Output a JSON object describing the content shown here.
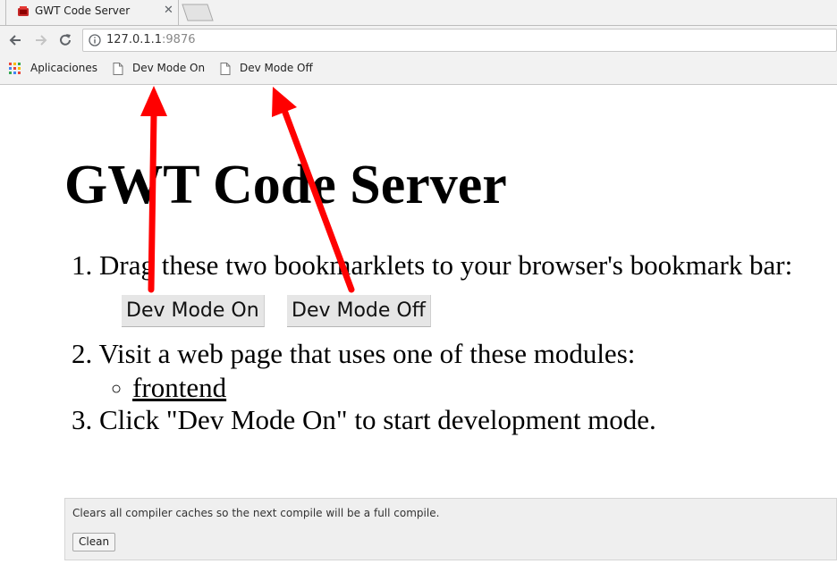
{
  "browser": {
    "tab_title": "GWT Code Server",
    "close_glyph": "✕",
    "url_host": "127.0.1.1",
    "url_port": ":9876",
    "bookmarks": [
      {
        "label": "Aplicaciones",
        "icon": "apps-grid-icon"
      },
      {
        "label": "Dev Mode On",
        "icon": "page-icon"
      },
      {
        "label": "Dev Mode Off",
        "icon": "page-icon"
      }
    ]
  },
  "page": {
    "title": "GWT Code Server",
    "steps": [
      {
        "number": "1.",
        "text": "Drag these two bookmarklets to your browser's bookmark bar:"
      },
      {
        "number": "2.",
        "text": "Visit a web page that uses one of these modules:"
      },
      {
        "number": "3.",
        "text": "Click \"Dev Mode On\" to start development mode."
      }
    ],
    "bookmarklet_buttons": [
      "Dev Mode On",
      "Dev Mode Off"
    ],
    "modules": [
      "frontend"
    ],
    "clean_panel": {
      "description": "Clears all compiler caches so the next compile will be a full compile.",
      "button_label": "Clean"
    }
  },
  "annotation_color": "#ff0000"
}
